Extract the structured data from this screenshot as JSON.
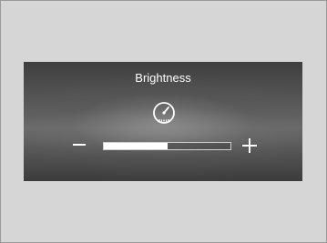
{
  "panel": {
    "title": "Brightness",
    "icon": "speedometer-icon",
    "decrease_icon": "minus-icon",
    "increase_icon": "plus-icon",
    "brightness_level": 0.5
  }
}
